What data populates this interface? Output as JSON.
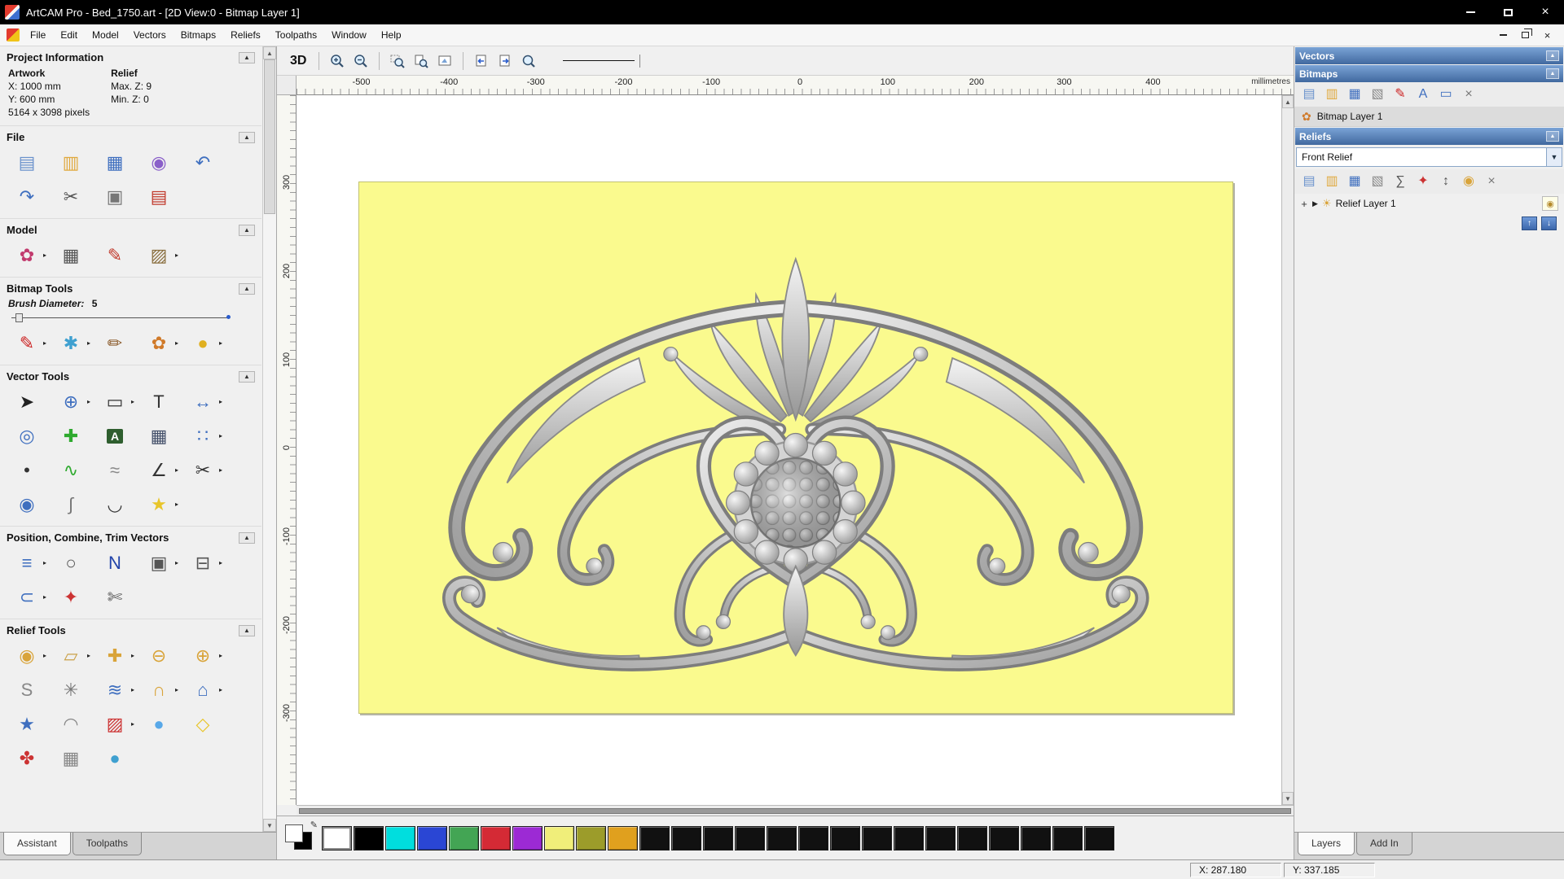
{
  "window": {
    "title": "ArtCAM Pro - Bed_1750.art - [2D View:0 - Bitmap Layer 1]"
  },
  "menu": {
    "items": [
      "File",
      "Edit",
      "Model",
      "Vectors",
      "Bitmaps",
      "Reliefs",
      "Toolpaths",
      "Window",
      "Help"
    ]
  },
  "toolbar": {
    "view3d_label": "3D"
  },
  "left_panel": {
    "sections": {
      "project_information": {
        "title": "Project Information",
        "artwork_label": "Artwork",
        "x": "X: 1000 mm",
        "y": "Y: 600 mm",
        "pixels": "5164 x 3098 pixels",
        "relief_label": "Relief",
        "max_z": "Max. Z: 9",
        "min_z": "Min. Z: 0"
      },
      "file": {
        "title": "File",
        "icons": [
          {
            "name": "new-model-icon",
            "glyph": "▤",
            "color": "#6a92cc"
          },
          {
            "name": "open-model-icon",
            "glyph": "▥",
            "color": "#e0a93e"
          },
          {
            "name": "save-model-icon",
            "glyph": "▦",
            "color": "#3f6fbf"
          },
          {
            "name": "import-export-icon",
            "glyph": "◉",
            "color": "#8a5fc9"
          },
          {
            "name": "undo-icon",
            "glyph": "↶",
            "color": "#3f6fbf"
          },
          {
            "name": "redo-icon",
            "glyph": "↷",
            "color": "#3f6fbf"
          },
          {
            "name": "cut-icon",
            "glyph": "✂",
            "color": "#555555"
          },
          {
            "name": "copy-icon",
            "glyph": "▣",
            "color": "#777777"
          },
          {
            "name": "paste-icon",
            "glyph": "▤",
            "color": "#c0392b"
          }
        ]
      },
      "model": {
        "title": "Model",
        "icons": [
          {
            "name": "model-properties-icon",
            "glyph": "✿",
            "color": "#c23b6e",
            "arrow": true
          },
          {
            "name": "greyscale-texture-icon",
            "glyph": "▦",
            "color": "#555555"
          },
          {
            "name": "set-model-size-icon",
            "glyph": "✎",
            "color": "#c0392b"
          },
          {
            "name": "model-image-icon",
            "glyph": "▨",
            "color": "#8a6f3f",
            "arrow": true
          }
        ]
      },
      "bitmap_tools": {
        "title": "Bitmap Tools",
        "brush_label": "Brush Diameter:",
        "brush_value": "5",
        "icons": [
          {
            "name": "paint-brush-icon",
            "glyph": "✎",
            "color": "#cc2222",
            "arrow": true
          },
          {
            "name": "colour-blend-icon",
            "glyph": "✱",
            "color": "#3fa0d0",
            "arrow": true
          },
          {
            "name": "pick-colour-icon",
            "glyph": "✏",
            "color": "#8a5a2a"
          },
          {
            "name": "palette-icon",
            "glyph": "✿",
            "color": "#d07a2a",
            "arrow": true
          },
          {
            "name": "flood-fill-icon",
            "glyph": "●",
            "color": "#e0b020",
            "arrow": true
          }
        ]
      },
      "vector_tools": {
        "title": "Vector Tools",
        "icons": [
          {
            "name": "select-vectors-icon",
            "glyph": "➤",
            "color": "#222222"
          },
          {
            "name": "transform-vectors-icon",
            "glyph": "⊕",
            "color": "#3f6fbf",
            "arrow": true
          },
          {
            "name": "create-rectangle-icon",
            "glyph": "▭",
            "color": "#333333",
            "arrow": true
          },
          {
            "name": "create-text-icon",
            "glyph": "T",
            "color": "#333333"
          },
          {
            "name": "measure-icon",
            "glyph": "↔",
            "color": "#3f6fbf",
            "arrow": true
          },
          {
            "name": "offset-vectors-icon",
            "glyph": "◎",
            "color": "#3f6fbf"
          },
          {
            "name": "node-editing-icon",
            "glyph": "✚",
            "color": "#2faa2f"
          },
          {
            "name": "wrap-text-icon",
            "glyph": "A",
            "color": "#ffffff",
            "bg": "#2e5e2e"
          },
          {
            "name": "snap-grid-icon",
            "glyph": "▦",
            "color": "#44506a"
          },
          {
            "name": "block-array-copy-icon",
            "glyph": "∷",
            "color": "#3f6fbf",
            "arrow": true
          },
          {
            "name": "create-point-icon",
            "glyph": "•",
            "color": "#333333"
          },
          {
            "name": "freehand-curve-icon",
            "glyph": "∿",
            "color": "#2faa2f"
          },
          {
            "name": "bezier-curve-icon",
            "glyph": "≈",
            "color": "#888888"
          },
          {
            "name": "create-polyline-icon",
            "glyph": "∠",
            "color": "#333333",
            "arrow": true
          },
          {
            "name": "cut-nodes-icon",
            "glyph": "✂",
            "color": "#333333",
            "arrow": true
          },
          {
            "name": "create-doughnut-icon",
            "glyph": "◉",
            "color": "#3f6fbf"
          },
          {
            "name": "curve-edit-icon",
            "glyph": "∫",
            "color": "#777777"
          },
          {
            "name": "join-vectors-icon",
            "glyph": "◡",
            "color": "#333333"
          },
          {
            "name": "create-star-icon",
            "glyph": "★",
            "color": "#e8c52a",
            "arrow": true
          }
        ]
      },
      "position_combine": {
        "title": "Position, Combine, Trim Vectors",
        "icons": [
          {
            "name": "align-vectors-icon",
            "glyph": "≡",
            "color": "#3f6fbf",
            "arrow": true
          },
          {
            "name": "circular-copy-icon",
            "glyph": "○",
            "color": "#555555"
          },
          {
            "name": "nesting-icon",
            "glyph": "N",
            "color": "#2244aa"
          },
          {
            "name": "group-vectors-icon",
            "glyph": "▣",
            "color": "#555555",
            "arrow": true
          },
          {
            "name": "slice-vectors-icon",
            "glyph": "⊟",
            "color": "#555555",
            "arrow": true
          },
          {
            "name": "weld-vectors-icon",
            "glyph": "⊂",
            "color": "#3f6fbf",
            "arrow": true
          },
          {
            "name": "cross-hatch-icon",
            "glyph": "✦",
            "color": "#cc3333"
          },
          {
            "name": "trim-vectors-icon",
            "glyph": "✄",
            "color": "#555555"
          }
        ]
      },
      "relief_tools": {
        "title": "Relief Tools",
        "icons": [
          {
            "name": "smooth-relief-icon",
            "glyph": "◉",
            "color": "#d9a43a",
            "arrow": true
          },
          {
            "name": "sculpting-icon",
            "glyph": "▱",
            "color": "#caa24a",
            "arrow": true
          },
          {
            "name": "add-relief-icon",
            "glyph": "✚",
            "color": "#d9a43a",
            "arrow": true
          },
          {
            "name": "subtract-relief-icon",
            "glyph": "⊖",
            "color": "#d9a43a"
          },
          {
            "name": "merge-relief-icon",
            "glyph": "⊕",
            "color": "#d9a43a",
            "arrow": true
          },
          {
            "name": "smoothing-icon",
            "glyph": "S",
            "color": "#888888"
          },
          {
            "name": "weave-wizard-icon",
            "glyph": "✳",
            "color": "#777777"
          },
          {
            "name": "offset-relief-icon",
            "glyph": "≋",
            "color": "#3f6fbf",
            "arrow": true
          },
          {
            "name": "two-rail-sweep-icon",
            "glyph": "∩",
            "color": "#d9a43a",
            "arrow": true
          },
          {
            "name": "envelope-distortion-icon",
            "glyph": "⌂",
            "color": "#3f6fbf",
            "arrow": true
          },
          {
            "name": "star-relief-icon",
            "glyph": "★",
            "color": "#3f6fbf"
          },
          {
            "name": "dome-relief-icon",
            "glyph": "◠",
            "color": "#888888"
          },
          {
            "name": "texture-relief-icon",
            "glyph": "▨",
            "color": "#cc3333",
            "arrow": true
          },
          {
            "name": "interactive-sculpt-icon",
            "glyph": "●",
            "color": "#58a8e8"
          },
          {
            "name": "unwrap-relief-icon",
            "glyph": "◇",
            "color": "#e8c52a"
          },
          {
            "name": "face-wizard-icon",
            "glyph": "✤",
            "color": "#cc3333"
          },
          {
            "name": "mesh-relief-icon",
            "glyph": "▦",
            "color": "#888888"
          },
          {
            "name": "sphere-relief-icon",
            "glyph": "●",
            "color": "#3fa0d0"
          }
        ]
      }
    },
    "tabs": [
      {
        "label": "Assistant"
      },
      {
        "label": "Toolpaths"
      }
    ]
  },
  "rulers": {
    "unit": "millimetres",
    "h": [
      "-500",
      "-400",
      "-300",
      "-200",
      "-100",
      "0",
      "100",
      "200",
      "300",
      "400"
    ],
    "v": [
      "300",
      "200",
      "100",
      "0",
      "-100",
      "-200",
      "-300"
    ]
  },
  "right_panel": {
    "vectors": {
      "title": "Vectors"
    },
    "bitmaps": {
      "title": "Bitmaps",
      "layer_label": "Bitmap Layer 1",
      "icons": [
        {
          "name": "new-bitmap-layer-icon",
          "glyph": "▤",
          "color": "#6a92cc"
        },
        {
          "name": "open-bitmap-layer-icon",
          "glyph": "▥",
          "color": "#e0a93e"
        },
        {
          "name": "save-bitmap-layer-icon",
          "glyph": "▦",
          "color": "#3f6fbf"
        },
        {
          "name": "bitmap-to-vector-icon",
          "glyph": "▧",
          "color": "#888888"
        },
        {
          "name": "paint-layer-icon",
          "glyph": "✎",
          "color": "#cc2222"
        },
        {
          "name": "text-layer-icon",
          "glyph": "A",
          "color": "#3f6fbf"
        },
        {
          "name": "clear-layer-icon",
          "glyph": "▭",
          "color": "#3f6fbf"
        },
        {
          "name": "delete-bitmap-layer-icon",
          "glyph": "×",
          "color": "#777777"
        }
      ]
    },
    "reliefs": {
      "title": "Reliefs",
      "selected_relief": "Front Relief",
      "layer_label": "Relief Layer 1",
      "icons": [
        {
          "name": "new-relief-layer-icon",
          "glyph": "▤",
          "color": "#6a92cc"
        },
        {
          "name": "open-relief-layer-icon",
          "glyph": "▥",
          "color": "#e0a93e"
        },
        {
          "name": "save-relief-layer-icon",
          "glyph": "▦",
          "color": "#3f6fbf"
        },
        {
          "name": "import-relief-icon",
          "glyph": "▧",
          "color": "#888888"
        },
        {
          "name": "calculate-relief-icon",
          "glyph": "∑",
          "color": "#555555"
        },
        {
          "name": "relief-wizard-icon",
          "glyph": "✦",
          "color": "#cc3333"
        },
        {
          "name": "scale-relief-icon",
          "glyph": "↕",
          "color": "#555555"
        },
        {
          "name": "smooth-relief-layer-icon",
          "glyph": "◉",
          "color": "#d9a43a"
        },
        {
          "name": "delete-relief-layer-icon",
          "glyph": "×",
          "color": "#777777"
        }
      ]
    },
    "tabs": [
      {
        "label": "Layers"
      },
      {
        "label": "Add In"
      }
    ]
  },
  "palette": {
    "primary": "#ffffff",
    "secondary": "#000000",
    "colors": [
      "#ffffff",
      "#000000",
      "#00dede",
      "#2a46d4",
      "#43a554",
      "#d42a35",
      "#9c2ad4",
      "#f0ee7a",
      "#9c9c2a",
      "#e0a01e",
      "#111111",
      "#111111",
      "#111111",
      "#111111",
      "#111111",
      "#111111",
      "#111111",
      "#111111",
      "#111111",
      "#111111",
      "#111111",
      "#111111",
      "#111111",
      "#111111",
      "#111111"
    ]
  },
  "status": {
    "x": "X: 287.180",
    "y": "Y: 337.185"
  }
}
